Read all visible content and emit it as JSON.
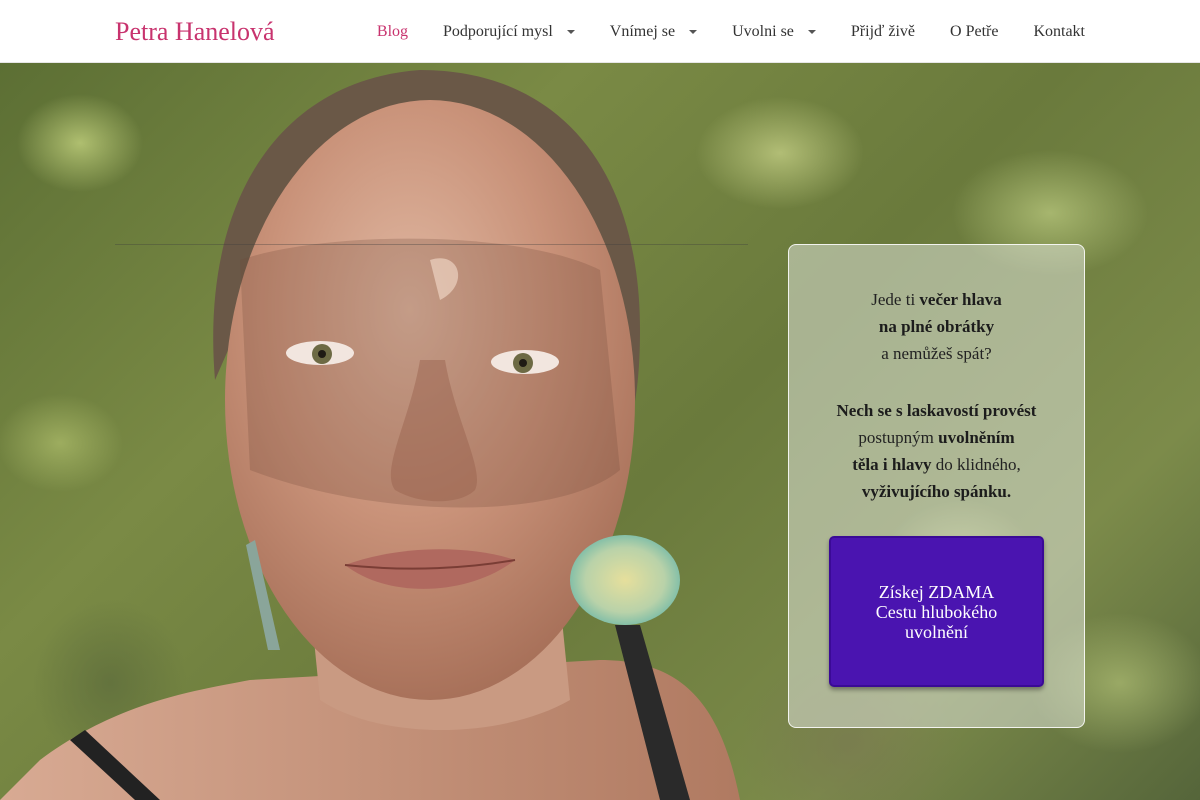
{
  "header": {
    "site_title": "Petra Hanelová",
    "nav": [
      {
        "label": "Blog",
        "active": true,
        "has_dropdown": false
      },
      {
        "label": "Podporující mysl",
        "active": false,
        "has_dropdown": true
      },
      {
        "label": "Vnímej se",
        "active": false,
        "has_dropdown": true
      },
      {
        "label": "Uvolni se",
        "active": false,
        "has_dropdown": true
      },
      {
        "label": "Přijď živě",
        "active": false,
        "has_dropdown": false
      },
      {
        "label": "O Petře",
        "active": false,
        "has_dropdown": false
      },
      {
        "label": "Kontakt",
        "active": false,
        "has_dropdown": false
      }
    ]
  },
  "hero": {
    "card": {
      "line1_plain": "Jede ti ",
      "line1_bold": "večer hlava",
      "line2_bold": "na plné obrátky",
      "line3_plain": "a nemůžeš spát?",
      "line4_bold": "Nech se s laskavostí provést",
      "line5_plain": "postupným ",
      "line5_bold": "uvolněním",
      "line6_bold": "těla i hlavy",
      "line6_plain": " do klidného,",
      "line7_bold": "vyživujícího spánku.",
      "cta_label": "Získej ZDAMA Cestu hlubokého uvolnění"
    }
  },
  "colors": {
    "brand": "#c8336e",
    "cta": "#4a14b0"
  }
}
